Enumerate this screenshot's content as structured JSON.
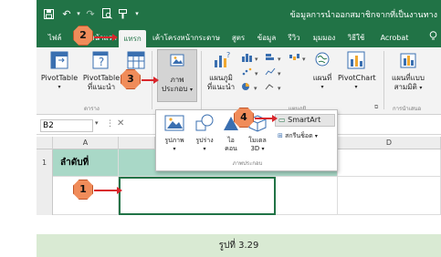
{
  "window": {
    "doc_title": "ข้อมูลการนำออกสมาชิกจากที่เป็นงานทาง"
  },
  "tabs": [
    {
      "label": "ไฟล์",
      "active": false
    },
    {
      "label": "หน้าแรก",
      "active": false
    },
    {
      "label": "แทรก",
      "active": true
    },
    {
      "label": "เค้าโครงหน้ากระดาษ",
      "active": false
    },
    {
      "label": "สูตร",
      "active": false
    },
    {
      "label": "ข้อมูล",
      "active": false
    },
    {
      "label": "รีวิว",
      "active": false
    },
    {
      "label": "มุมมอง",
      "active": false
    },
    {
      "label": "วิธีใช้",
      "active": false
    },
    {
      "label": "Acrobat",
      "active": false
    }
  ],
  "ribbon": {
    "pivottable": "PivotTable",
    "recommended_pivot_1": "PivotTable",
    "recommended_pivot_2": "ที่แนะนำ",
    "tables_group": "ตาราง",
    "illustrations_1": "ภาพ",
    "illustrations_2": "ประกอบ",
    "recommended_charts_1": "แผนภูมิ",
    "recommended_charts_2": "ที่แนะนำ",
    "maps": "แผนที่",
    "pivotchart": "PivotChart",
    "charts_group": "แผนภูมิ",
    "threed_map_1": "แผนที่แบบ",
    "threed_map_2": "สามมิติ",
    "tours_group": "การนำเสนอ"
  },
  "formula_bar": {
    "name_box": "B2"
  },
  "sheet": {
    "columns": [
      "A",
      "D"
    ],
    "rows": [
      "1"
    ],
    "cell_a1": "ลำดับที่"
  },
  "illustrations_menu": {
    "pictures_1": "รูปภาพ",
    "shapes": "รูปร่าง",
    "icons_1": "ไอ",
    "icons_2": "คอน",
    "models_1": "โมเดล",
    "models_2": "3D",
    "smartart": "SmartArt",
    "screenshot": "สกรีนช็อต",
    "footer": "ภาพประกอบ"
  },
  "callouts": [
    "1",
    "2",
    "3",
    "4"
  ],
  "caption": "รูปที่ 3.29",
  "colors": {
    "excel_green": "#217346",
    "callout_orange": "#f08c5a",
    "arrow_red": "#d9262c",
    "caption_bg": "#d9ead3"
  }
}
